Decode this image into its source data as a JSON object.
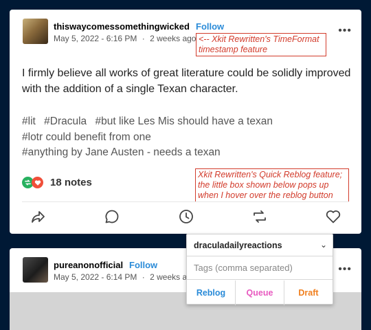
{
  "post1": {
    "username": "thiswaycomessomethingwicked",
    "follow_label": "Follow",
    "date": "May 5, 2022 - 6:16 PM",
    "separator": "·",
    "relative_time": "2 weeks ago",
    "more_label": "•••",
    "body": "I firmly believe all works of great literature could be solidly improved with the addition of a single Texan character.",
    "tags": [
      "#lit",
      "#Dracula",
      "#but like Les Mis should have a texan",
      "#lotr could benefit from one",
      "#anything by Jane Austen - needs a texan"
    ],
    "notes": "18 notes",
    "actions": [
      "share-icon",
      "reply-icon",
      "queue-clock-icon",
      "reblog-icon",
      "like-heart-icon"
    ]
  },
  "annotations": {
    "timeformat": "<-- Xkit Rewritten's TimeFormat timestamp feature",
    "quickreblog": "Xkit Rewritten's Quick Reblog feature; the little box shown below pops up when I hover over the reblog button"
  },
  "post2": {
    "username": "pureanonofficial",
    "follow_label": "Follow",
    "date": "May 5, 2022 - 6:14 PM",
    "separator": "·",
    "relative_time": "2 weeks ag",
    "more_label": "•••"
  },
  "quick_reblog": {
    "blog": "draculadailyreactions",
    "chevron": "⌄",
    "tags_placeholder": "Tags (comma separated)",
    "reblog_label": "Reblog",
    "queue_label": "Queue",
    "draft_label": "Draft"
  },
  "colors": {
    "background": "#001935",
    "follow": "#2a8bd8",
    "annotation": "#d23b2b",
    "reblog_btn": "#2a8bd8",
    "queue_btn": "#e85ac0",
    "draft_btn": "#f07f1e",
    "reblog_note": "#27b15f",
    "like_note": "#f04f3a"
  }
}
